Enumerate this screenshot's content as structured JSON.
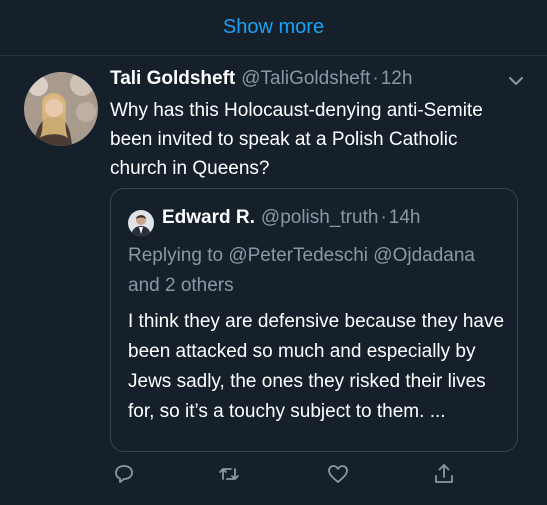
{
  "show_more": {
    "label": "Show more"
  },
  "tweet": {
    "author_name": "Tali Goldsheft",
    "author_handle": "@TaliGoldsheft",
    "separator": "·",
    "time": "12h",
    "text": "Why has this Holocaust-denying anti-Semite been invited to speak at a Polish Catholic church in Queens?"
  },
  "quoted_tweet": {
    "author_name": "Edward R.",
    "author_handle": "@polish_truth",
    "separator": "·",
    "time": "14h",
    "replying_to": "Replying to @PeterTedeschi @Ojdadana and 2 others",
    "text": "I think they are defensive because they have been attacked so much and especially by Jews sadly, the ones they risked their lives for, so it’s a touchy subject to them. ..."
  },
  "actions": [
    {
      "icon": "reply-icon"
    },
    {
      "icon": "retweet-icon"
    },
    {
      "icon": "like-icon"
    },
    {
      "icon": "share-icon"
    }
  ],
  "colors": {
    "background": "#15202b",
    "accent": "#1da1f2",
    "secondary_text": "#8899a6",
    "border": "#38444d"
  }
}
